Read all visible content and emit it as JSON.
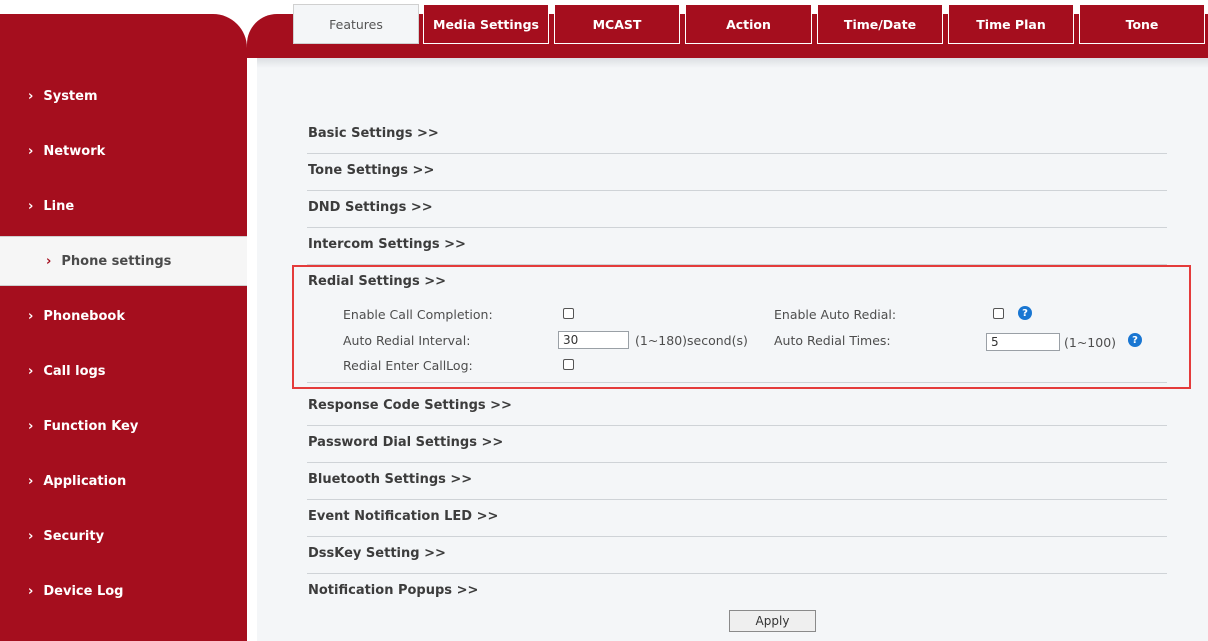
{
  "sidebar": {
    "items": [
      {
        "label": "System",
        "active": false
      },
      {
        "label": "Network",
        "active": false
      },
      {
        "label": "Line",
        "active": false
      },
      {
        "label": "Phone settings",
        "active": true
      },
      {
        "label": "Phonebook",
        "active": false
      },
      {
        "label": "Call logs",
        "active": false
      },
      {
        "label": "Function Key",
        "active": false
      },
      {
        "label": "Application",
        "active": false
      },
      {
        "label": "Security",
        "active": false
      },
      {
        "label": "Device Log",
        "active": false
      }
    ],
    "chevron": "›"
  },
  "tabs": [
    {
      "label": "Features",
      "active": true
    },
    {
      "label": "Media Settings",
      "active": false
    },
    {
      "label": "MCAST",
      "active": false
    },
    {
      "label": "Action",
      "active": false
    },
    {
      "label": "Time/Date",
      "active": false
    },
    {
      "label": "Time Plan",
      "active": false
    },
    {
      "label": "Tone",
      "active": false
    }
  ],
  "sections": {
    "basic": "Basic Settings >>",
    "tone": "Tone Settings >>",
    "dnd": "DND Settings >>",
    "intercom": "Intercom Settings >>",
    "redial": "Redial Settings >>",
    "response_code": "Response Code Settings >>",
    "password_dial": "Password Dial Settings >>",
    "bluetooth": "Bluetooth Settings >>",
    "event_led": "Event Notification LED >>",
    "dsskey": "DssKey Setting >>",
    "notification": "Notification Popups >>"
  },
  "redial": {
    "enable_call_completion_label": "Enable Call Completion:",
    "enable_auto_redial_label": "Enable Auto Redial:",
    "auto_redial_interval_label": "Auto Redial Interval:",
    "auto_redial_interval_value": "30",
    "auto_redial_interval_hint": "(1~180)second(s)",
    "auto_redial_times_label": "Auto Redial Times:",
    "auto_redial_times_value": "5",
    "auto_redial_times_hint": "(1~100)",
    "redial_enter_calllog_label": "Redial Enter CallLog:"
  },
  "apply_label": "Apply",
  "help_glyph": "?",
  "colors": {
    "brand": "#a50e1e",
    "content_bg": "#f4f6f8",
    "highlight_box": "#e43b3b",
    "help_icon": "#1976d2"
  }
}
